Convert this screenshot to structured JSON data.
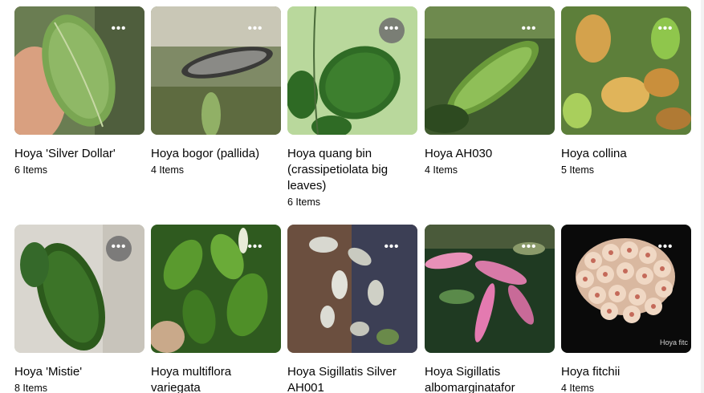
{
  "collections": [
    {
      "title": "Hoya 'Silver Dollar'",
      "count": "6 Items"
    },
    {
      "title": "Hoya bogor (pallida)",
      "count": "4 Items"
    },
    {
      "title": "Hoya quang bin (crassipetiolata big leaves)",
      "count": "6 Items"
    },
    {
      "title": "Hoya AH030",
      "count": "4 Items"
    },
    {
      "title": "Hoya collina",
      "count": "5 Items"
    },
    {
      "title": "Hoya 'Mistie'",
      "count": "8 Items"
    },
    {
      "title": "Hoya multiflora variegata",
      "count": ""
    },
    {
      "title": "Hoya Sigillatis Silver AH001",
      "count": ""
    },
    {
      "title": "Hoya Sigillatis albomarginatafor",
      "count": ""
    },
    {
      "title": "Hoya fitchii",
      "count": "4 Items"
    }
  ],
  "more_button_label": "•••",
  "watermark_text": "Hoya fitc",
  "colors": {
    "text": "#050505",
    "more_button_bg": "#6e6e6e"
  },
  "icons": {
    "more": "more-options-icon"
  }
}
